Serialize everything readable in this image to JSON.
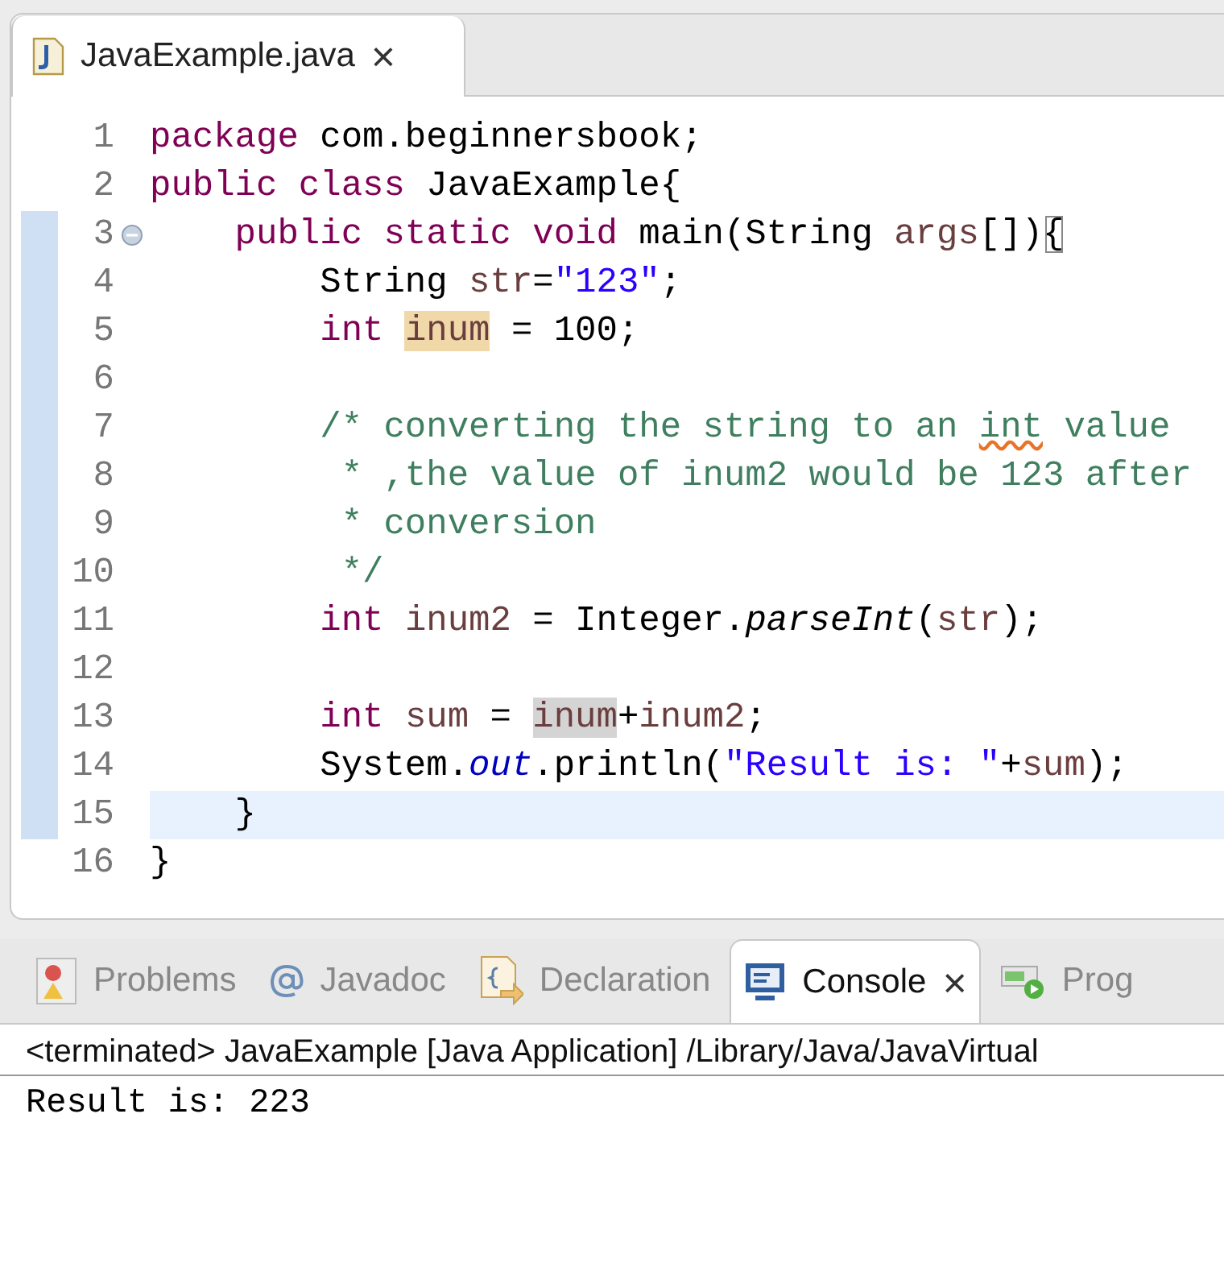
{
  "editor_tab": {
    "title": "JavaExample.java",
    "close": "×"
  },
  "code_lines": [
    {
      "number": "1",
      "changed": false,
      "current": false,
      "foldable": false,
      "tokens": [
        {
          "kind": "keyword",
          "text": "package "
        },
        {
          "kind": "text",
          "text": "com.beginnersbook;"
        }
      ]
    },
    {
      "number": "2",
      "changed": false,
      "current": false,
      "foldable": false,
      "tokens": [
        {
          "kind": "keyword",
          "text": "public "
        },
        {
          "kind": "keyword",
          "text": "class "
        },
        {
          "kind": "text",
          "text": "JavaExample{"
        }
      ]
    },
    {
      "number": "3",
      "changed": true,
      "current": false,
      "foldable": true,
      "tokens": [
        {
          "kind": "keyword",
          "text": "    public "
        },
        {
          "kind": "keyword",
          "text": "static "
        },
        {
          "kind": "keyword",
          "text": "void "
        },
        {
          "kind": "text",
          "text": "main(String "
        },
        {
          "kind": "param",
          "text": "args"
        },
        {
          "kind": "text",
          "text": "[])"
        },
        {
          "kind": "bracket-match",
          "text": "{"
        }
      ]
    },
    {
      "number": "4",
      "changed": true,
      "current": false,
      "foldable": false,
      "tokens": [
        {
          "kind": "text",
          "text": "        String "
        },
        {
          "kind": "param",
          "text": "str"
        },
        {
          "kind": "text",
          "text": "="
        },
        {
          "kind": "string",
          "text": "\"123\""
        },
        {
          "kind": "text",
          "text": ";"
        }
      ]
    },
    {
      "number": "5",
      "changed": true,
      "current": false,
      "foldable": false,
      "tokens": [
        {
          "kind": "keyword",
          "text": "        int "
        },
        {
          "kind": "occurrence-write",
          "text": "inum"
        },
        {
          "kind": "text",
          "text": " = 100;"
        }
      ]
    },
    {
      "number": "6",
      "changed": true,
      "current": false,
      "foldable": false
    },
    {
      "number": "7",
      "changed": true,
      "current": false,
      "foldable": false,
      "tokens": [
        {
          "kind": "comment",
          "text": "        /* converting the string to an "
        },
        {
          "kind": "spelling",
          "text": "int"
        },
        {
          "kind": "comment",
          "text": " value"
        }
      ]
    },
    {
      "number": "8",
      "changed": true,
      "current": false,
      "foldable": false,
      "tokens": [
        {
          "kind": "comment",
          "text": "         * ,the value of inum2 would be 123 after"
        }
      ]
    },
    {
      "number": "9",
      "changed": true,
      "current": false,
      "foldable": false,
      "tokens": [
        {
          "kind": "comment",
          "text": "         * conversion"
        }
      ]
    },
    {
      "number": "10",
      "changed": true,
      "current": false,
      "foldable": false,
      "tokens": [
        {
          "kind": "comment",
          "text": "         */"
        }
      ]
    },
    {
      "number": "11",
      "changed": true,
      "current": false,
      "foldable": false,
      "tokens": [
        {
          "kind": "keyword",
          "text": "        int "
        },
        {
          "kind": "param",
          "text": "inum2"
        },
        {
          "kind": "text",
          "text": " = Integer."
        },
        {
          "kind": "static-method",
          "text": "parseInt"
        },
        {
          "kind": "text",
          "text": "("
        },
        {
          "kind": "param",
          "text": "str"
        },
        {
          "kind": "text",
          "text": ");"
        }
      ]
    },
    {
      "number": "12",
      "changed": true,
      "current": false,
      "foldable": false
    },
    {
      "number": "13",
      "changed": true,
      "current": false,
      "foldable": false,
      "tokens": [
        {
          "kind": "keyword",
          "text": "        int "
        },
        {
          "kind": "param",
          "text": "sum"
        },
        {
          "kind": "text",
          "text": " = "
        },
        {
          "kind": "occurrence-read",
          "text": "inum"
        },
        {
          "kind": "text",
          "text": "+"
        },
        {
          "kind": "param",
          "text": "inum2"
        },
        {
          "kind": "text",
          "text": ";"
        }
      ]
    },
    {
      "number": "14",
      "changed": true,
      "current": false,
      "foldable": false,
      "tokens": [
        {
          "kind": "text",
          "text": "        System."
        },
        {
          "kind": "static-field",
          "text": "out"
        },
        {
          "kind": "text",
          "text": ".println("
        },
        {
          "kind": "string",
          "text": "\"Result is: \""
        },
        {
          "kind": "text",
          "text": "+"
        },
        {
          "kind": "param",
          "text": "sum"
        },
        {
          "kind": "text",
          "text": ");"
        }
      ]
    },
    {
      "number": "15",
      "changed": true,
      "current": true,
      "foldable": false,
      "tokens": [
        {
          "kind": "text",
          "text": "    }"
        }
      ]
    },
    {
      "number": "16",
      "changed": false,
      "current": false,
      "foldable": false,
      "tokens": [
        {
          "kind": "text",
          "text": "}"
        }
      ]
    }
  ],
  "bottom_tabs": [
    {
      "kind": "problems",
      "label": "Problems",
      "selected": false
    },
    {
      "kind": "javadoc",
      "label": "Javadoc",
      "selected": false
    },
    {
      "kind": "declaration",
      "label": "Declaration",
      "selected": false
    },
    {
      "kind": "console",
      "label": "Console",
      "selected": true,
      "close": "×"
    },
    {
      "kind": "progress",
      "label": "Prog",
      "selected": false
    }
  ],
  "console": {
    "header": "<terminated> JavaExample [Java Application] /Library/Java/JavaVirtual",
    "output": "Result is: 223"
  }
}
